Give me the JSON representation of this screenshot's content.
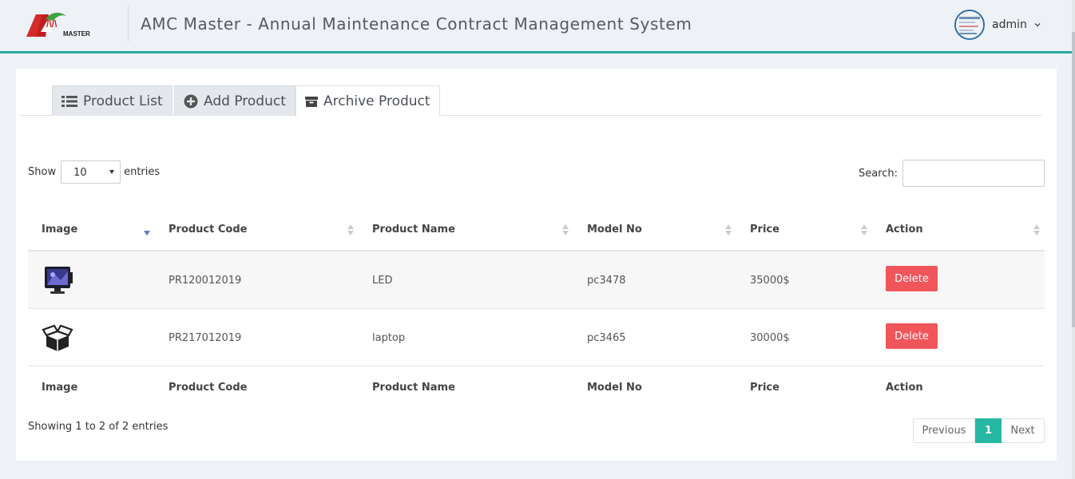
{
  "header": {
    "app_title": "AMC Master - Annual Maintenance Contract Management System",
    "logo_text": "AMC MASTER",
    "user_name": "admin"
  },
  "tabs": [
    {
      "label": "Product List",
      "icon": "list-icon",
      "active": false
    },
    {
      "label": "Add Product",
      "icon": "plus-circle-icon",
      "active": false
    },
    {
      "label": "Archive Product",
      "icon": "archive-icon",
      "active": true
    }
  ],
  "length": {
    "show_label": "Show",
    "value": "10",
    "entries_label": "entries"
  },
  "search": {
    "label": "Search:",
    "value": "",
    "placeholder": ""
  },
  "table": {
    "columns": [
      "Image",
      "Product Code",
      "Product Name",
      "Model No",
      "Price",
      "Action"
    ],
    "sorted_column": "Image",
    "sort_direction": "descending",
    "rows": [
      {
        "image": "monitor-icon",
        "code": "PR120012019",
        "name": "LED",
        "model": "pc3478",
        "price": "35000$",
        "action": "Delete"
      },
      {
        "image": "open-box-icon",
        "code": "PR217012019",
        "name": "laptop",
        "model": "pc3465",
        "price": "30000$",
        "action": "Delete"
      }
    ]
  },
  "info": "Showing 1 to 2 of 2 entries",
  "pagination": {
    "previous": "Previous",
    "current": "1",
    "next": "Next"
  },
  "colors": {
    "accent": "#26b8a3",
    "header_rule": "#27a9a0",
    "delete": "#f0555a"
  }
}
